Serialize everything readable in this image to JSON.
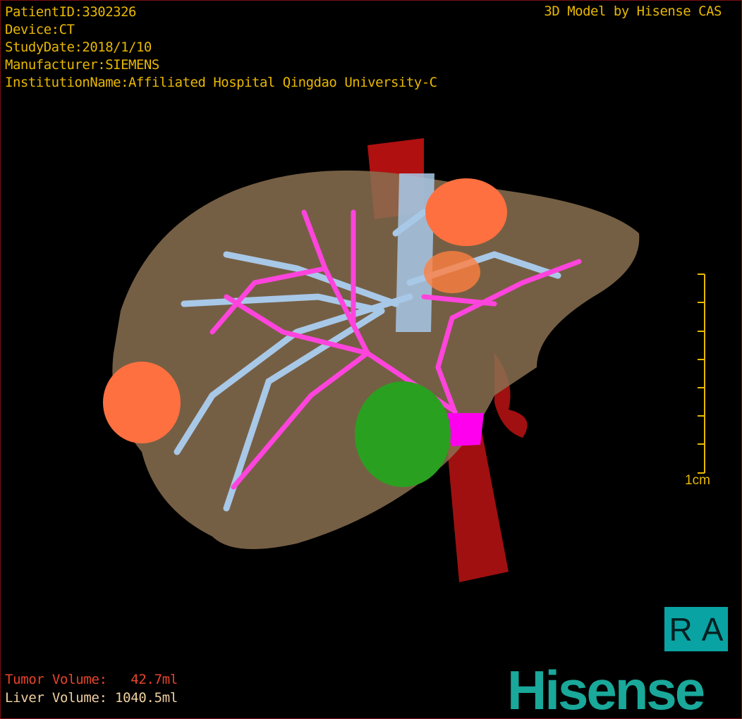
{
  "header": {
    "patient_id": "PatientID:3302326",
    "device": "Device:CT",
    "study_date": "StudyDate:2018/1/10",
    "manufacturer": "Manufacturer:SIEMENS",
    "institution": "InstitutionName:Affiliated Hospital Qingdao University-C",
    "credit": "3D Model by Hisense CAS"
  },
  "scale_bar": {
    "label": "1cm"
  },
  "orientation": {
    "left": "R",
    "right": "A"
  },
  "volumes": {
    "tumor": "Tumor Volume:   42.7ml",
    "liver": "Liver Volume: 1040.5ml"
  },
  "brand": "Hisense",
  "colors": {
    "text": "#e8b800",
    "liver": "#8a7050",
    "portal_vein": "#ff44dd",
    "hepatic_vein": "#a8c8e8",
    "artery": "#b01010",
    "tumor": "#ff7040",
    "gallbladder": "#2aa020",
    "brand": "#19a89a"
  }
}
